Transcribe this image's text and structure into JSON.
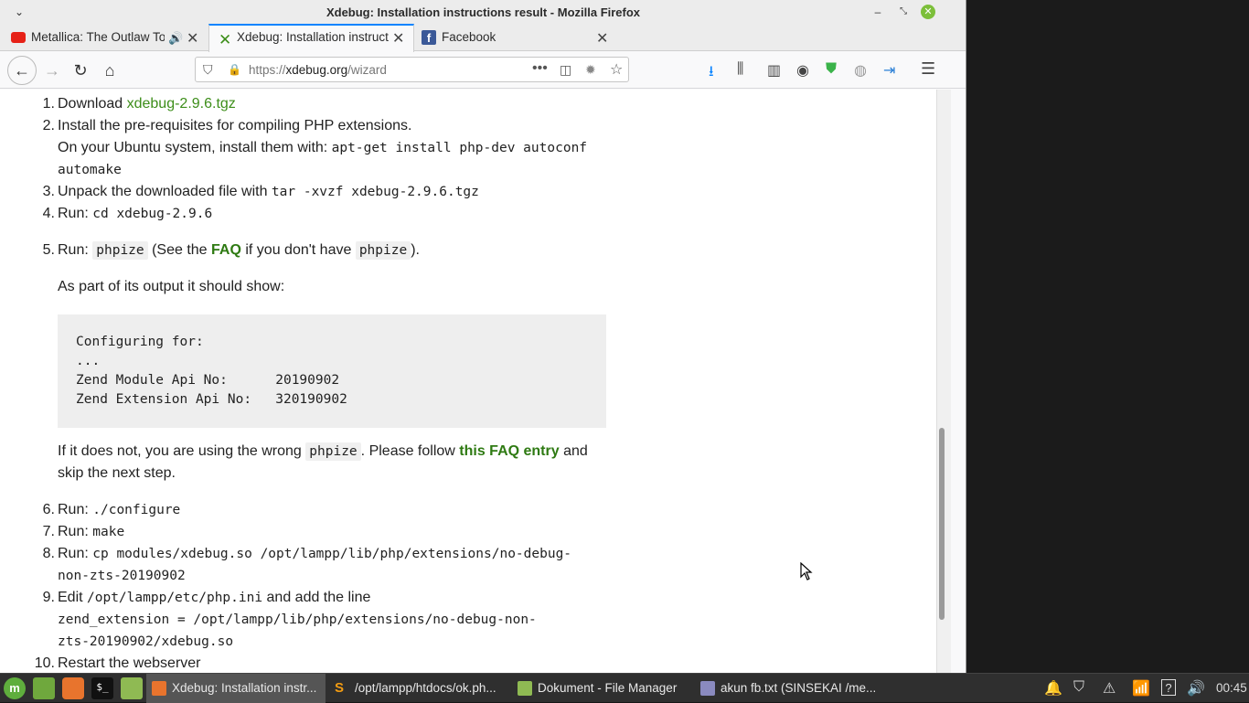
{
  "window": {
    "title": "Xdebug: Installation instructions result - Mozilla Firefox"
  },
  "tabs": [
    {
      "label": "Metallica: The Outlaw Torn",
      "audio": true
    },
    {
      "label": "Xdebug: Installation instructions result",
      "active": true
    },
    {
      "label": "Facebook"
    }
  ],
  "nav": {
    "url_prefix": "https://",
    "url_domain": "xdebug.org",
    "url_path": "/wizard"
  },
  "content": {
    "s1_a": "Download ",
    "s1_link": "xdebug-2.9.6.tgz",
    "s2_a": "Install the pre-requisites for compiling PHP extensions.",
    "s2_b": "On your Ubuntu system, install them with: ",
    "s2_code1": "apt-get install php-dev autoconf",
    "s2_code2": "automake",
    "s3_a": "Unpack the downloaded file with ",
    "s3_code": "tar -xvzf xdebug-2.9.6.tgz",
    "s4_a": "Run: ",
    "s4_code": "cd xdebug-2.9.6",
    "s5_a": "Run: ",
    "s5_code": "phpize",
    "s5_b": " (See the ",
    "s5_link": "FAQ",
    "s5_c": " if you don't have ",
    "s5_code2": "phpize",
    "s5_d": ").",
    "s5_out": "As part of its output it should show:",
    "s5_pre": "Configuring for:\n...\nZend Module Api No:      20190902\nZend Extension Api No:   320190902",
    "s5_e": "If it does not, you are using the wrong ",
    "s5_code3": "phpize",
    "s5_f": ". Please follow ",
    "s5_link2": "this FAQ entry",
    "s5_g": " and",
    "s5_h": "skip the next step.",
    "s6_a": "Run: ",
    "s6_code": "./configure",
    "s7_a": "Run: ",
    "s7_code": "make",
    "s8_a": "Run: ",
    "s8_code": "cp modules/xdebug.so /opt/lampp/lib/php/extensions/no-debug-",
    "s8_code2": "non-zts-20190902",
    "s9_a": "Edit ",
    "s9_code": "/opt/lampp/etc/php.ini",
    "s9_b": " and add the line",
    "s9_code2": "zend_extension = /opt/lampp/lib/php/extensions/no-debug-non-",
    "s9_code3": "zts-20190902/xdebug.so",
    "s10_a": "Restart the webserver"
  },
  "taskbar": {
    "windows": [
      {
        "label": "Xdebug: Installation instr...",
        "active": true
      },
      {
        "label": "/opt/lampp/htdocs/ok.ph..."
      },
      {
        "label": "Dokument - File Manager"
      },
      {
        "label": "akun fb.txt (SINSEKAI /me..."
      }
    ],
    "clock": "00:45"
  },
  "colors": {
    "accent": "#0a84ff",
    "link": "#3d8e1a",
    "taskbar": "#2f2f2f"
  }
}
